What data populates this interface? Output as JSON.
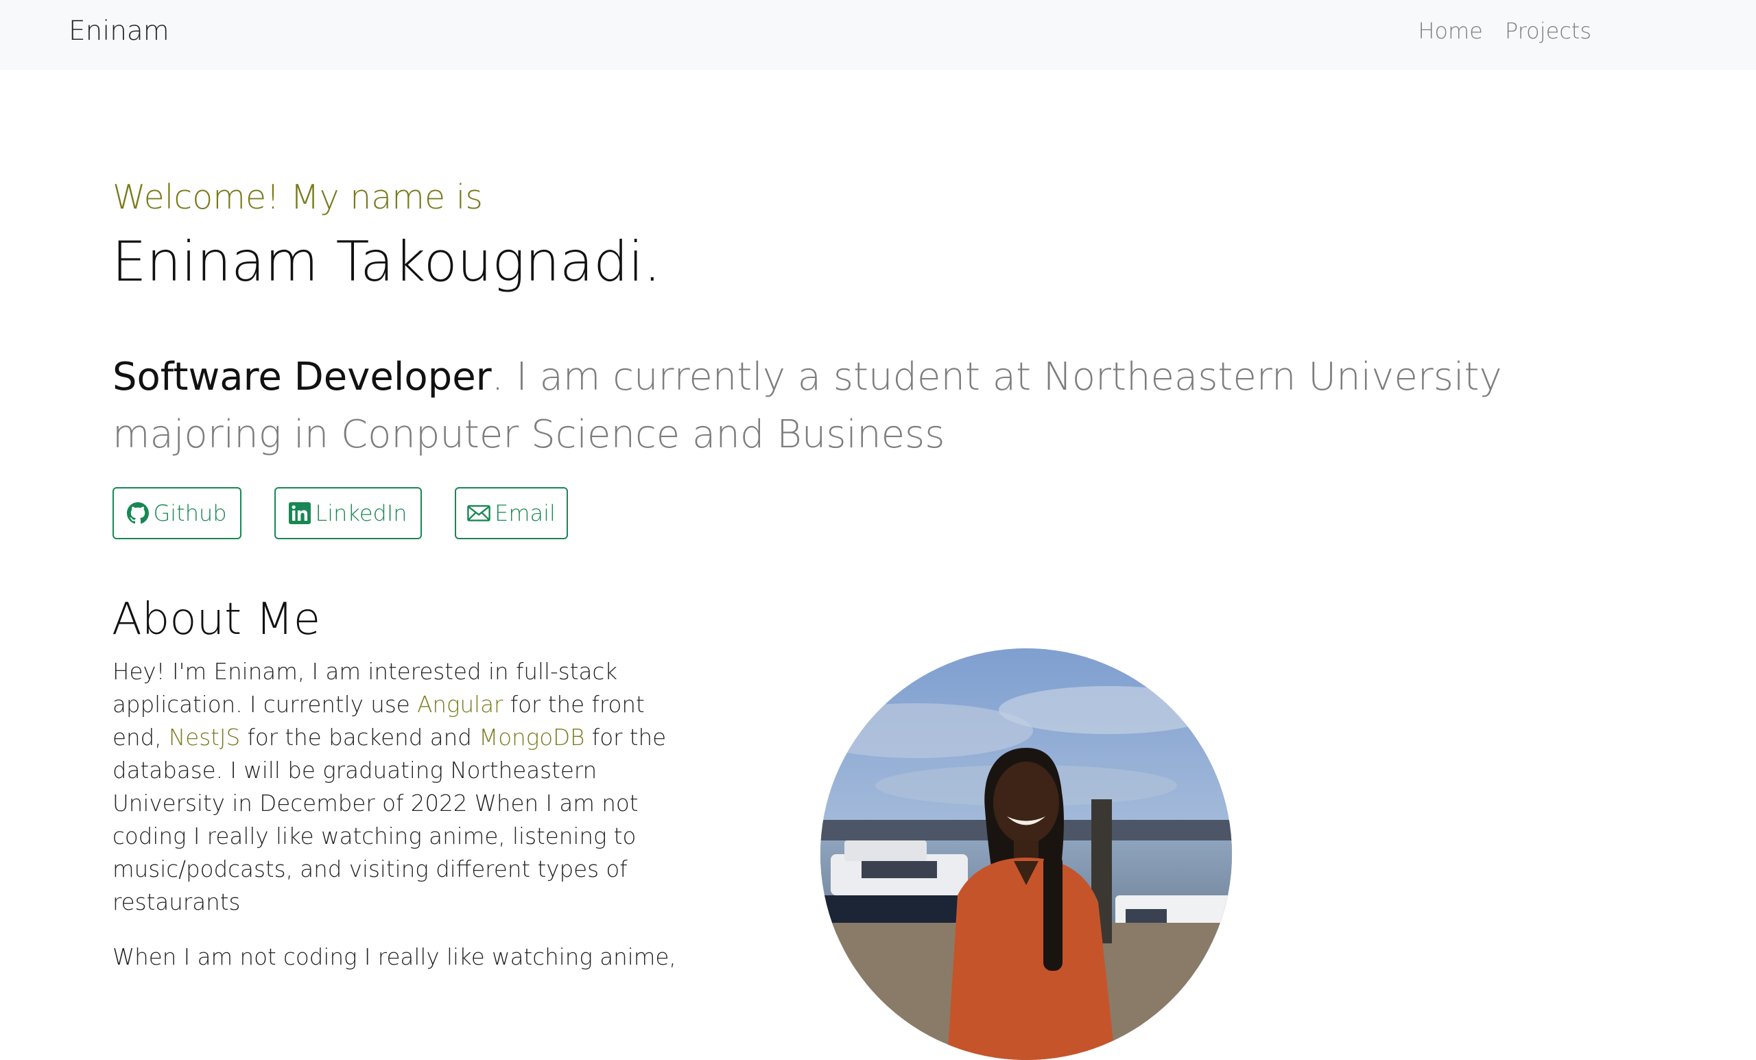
{
  "navbar": {
    "brand": "Eninam",
    "links": [
      "Home",
      "Projects"
    ]
  },
  "hero": {
    "welcome": "Welcome! My name is",
    "name": "Eninam Takougnadi.",
    "role": "Software Developer",
    "intro_rest": ". I am currently a student at Northeastern University majoring in Conputer Science and Business"
  },
  "buttons": {
    "github": "Github",
    "linkedin": "LinkedIn",
    "email": "Email"
  },
  "about": {
    "title": "About Me",
    "p1_a": "Hey! I'm Eninam, I am interested in full-stack application. I currently use ",
    "tech_frontend": "Angular",
    "p1_b": " for the front end, ",
    "tech_backend": "NestJS",
    "p1_c": " for the backend and ",
    "tech_database": "MongoDB",
    "p1_d": " for the database. I will be graduating Northeastern University in December of 2022 When I am not coding I really like watching anime, listening to music/podcasts, and visiting different types of restaurants",
    "p2": "When I am not coding I really like watching anime,"
  },
  "colors": {
    "accent_olive": "#7a7a1e",
    "button_green": "#198754",
    "navbar_bg": "#f8f9fa"
  },
  "icons": [
    "github-icon",
    "linkedin-icon",
    "envelope-icon"
  ]
}
